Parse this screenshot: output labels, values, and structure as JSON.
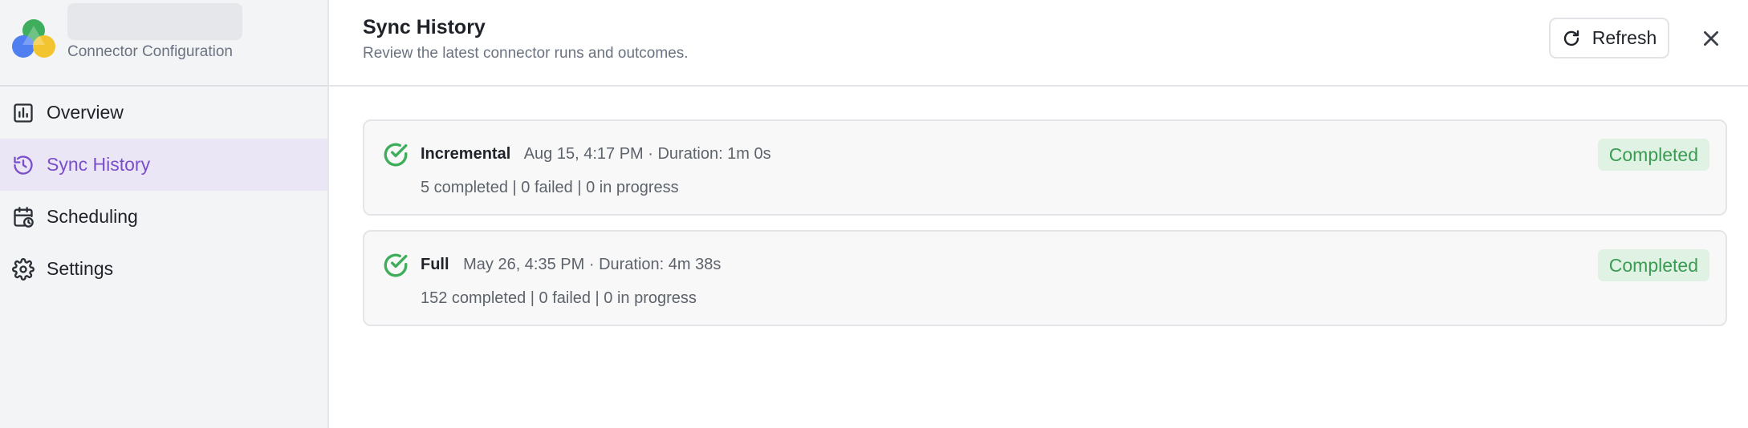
{
  "brand": {
    "subtitle": "Connector Configuration"
  },
  "sidebar": {
    "items": [
      {
        "label": "Overview",
        "icon": "bar-chart-icon",
        "active": false
      },
      {
        "label": "Sync History",
        "icon": "history-icon",
        "active": true
      },
      {
        "label": "Scheduling",
        "icon": "calendar-clock-icon",
        "active": false
      },
      {
        "label": "Settings",
        "icon": "gear-icon",
        "active": false
      }
    ]
  },
  "header": {
    "title": "Sync History",
    "subtitle": "Review the latest connector runs and outcomes.",
    "refresh_label": "Refresh"
  },
  "runs": [
    {
      "type": "Incremental",
      "meta": "Aug 15, 4:17 PM · Duration: 1m 0s",
      "summary": "5 completed | 0 failed | 0 in progress",
      "status": "Completed"
    },
    {
      "type": "Full",
      "meta": "May 26, 4:35 PM · Duration: 4m 38s",
      "summary": "152 completed | 0 failed | 0 in progress",
      "status": "Completed"
    }
  ],
  "colors": {
    "accent": "#7a4fc9",
    "active_bg": "#ebe6f6",
    "success": "#3fae5c",
    "success_bg": "#e0f2e3"
  }
}
